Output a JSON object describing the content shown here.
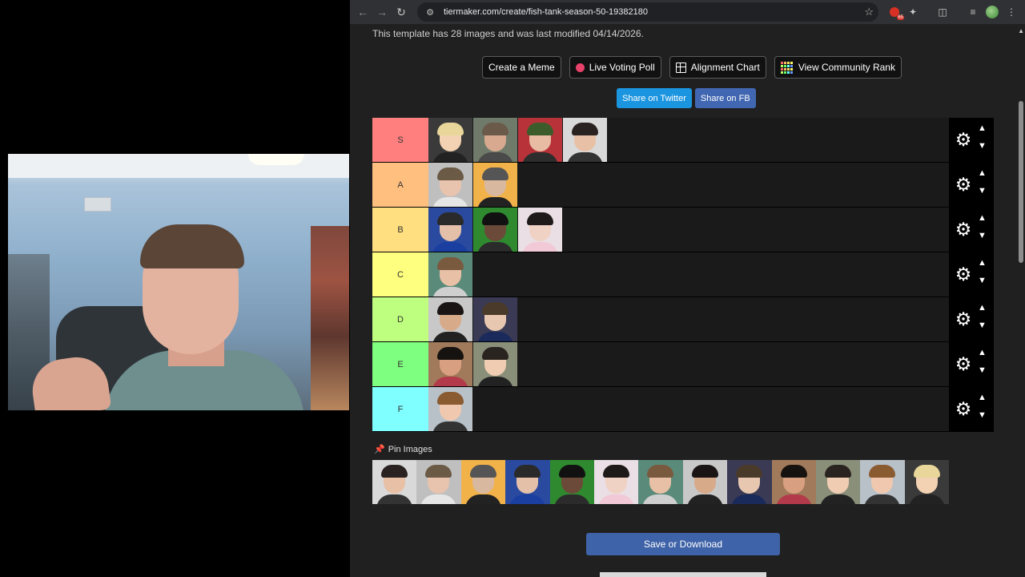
{
  "browser": {
    "url": "tiermaker.com/create/fish-tank-season-50-19382180",
    "ext_badge": "65"
  },
  "page": {
    "template_info": "This template has 28 images and was last modified 04/14/2026.",
    "buttons": {
      "create_meme": "Create a Meme",
      "live_poll": "Live Voting Poll",
      "alignment": "Alignment Chart",
      "community_rank": "View Community Rank"
    },
    "share": {
      "twitter": "Share on Twitter",
      "facebook": "Share on FB"
    },
    "pin_images": "Pin Images",
    "save_download": "Save or Download"
  },
  "tiers": [
    {
      "label": "S",
      "color": "#ff7f7f",
      "count": 4
    },
    {
      "label": "A",
      "color": "#ffbf7f",
      "count": 2
    },
    {
      "label": "B",
      "color": "#ffdf7f",
      "count": 3
    },
    {
      "label": "C",
      "color": "#ffff7f",
      "count": 1
    },
    {
      "label": "D",
      "color": "#bfff7f",
      "count": 2
    },
    {
      "label": "E",
      "color": "#7fff7f",
      "count": 2
    },
    {
      "label": "F",
      "color": "#7fffff",
      "count": 1
    }
  ],
  "pool_count": 13,
  "icons": {
    "back": "arrow-left-icon",
    "forward": "arrow-right-icon",
    "reload": "reload-icon",
    "bookmark": "star-icon",
    "settings": "gear-icon"
  }
}
